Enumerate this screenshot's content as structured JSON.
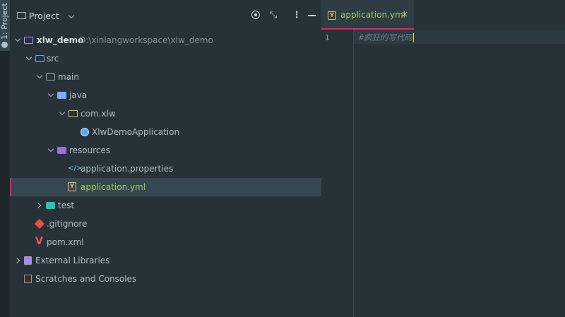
{
  "side_stripe": {
    "project_tab_label": "1: Project"
  },
  "panel": {
    "title": "Project"
  },
  "tree": [
    {
      "label": "xlw_demo",
      "path": "D:\\xinlangworkspace\\xlw_demo"
    },
    {
      "label": "src"
    },
    {
      "label": "main"
    },
    {
      "label": "java"
    },
    {
      "label": "com.xlw"
    },
    {
      "label": "XlwDemoApplication"
    },
    {
      "label": "resources"
    },
    {
      "label": "application.properties"
    },
    {
      "label": "application.yml"
    },
    {
      "label": "test"
    },
    {
      "label": ".gitignore"
    },
    {
      "label": "pom.xml"
    },
    {
      "label": "External Libraries"
    },
    {
      "label": "Scratches and Consoles"
    }
  ],
  "editor": {
    "tab": {
      "label": "application.yml",
      "close": "×"
    },
    "line_number": "1",
    "code_line": "#疯狂的写代码"
  },
  "colors": {
    "background": "#263238",
    "accent": "#e91e63",
    "selected_row": "#37474f",
    "yml_label": "#9ccc65"
  }
}
